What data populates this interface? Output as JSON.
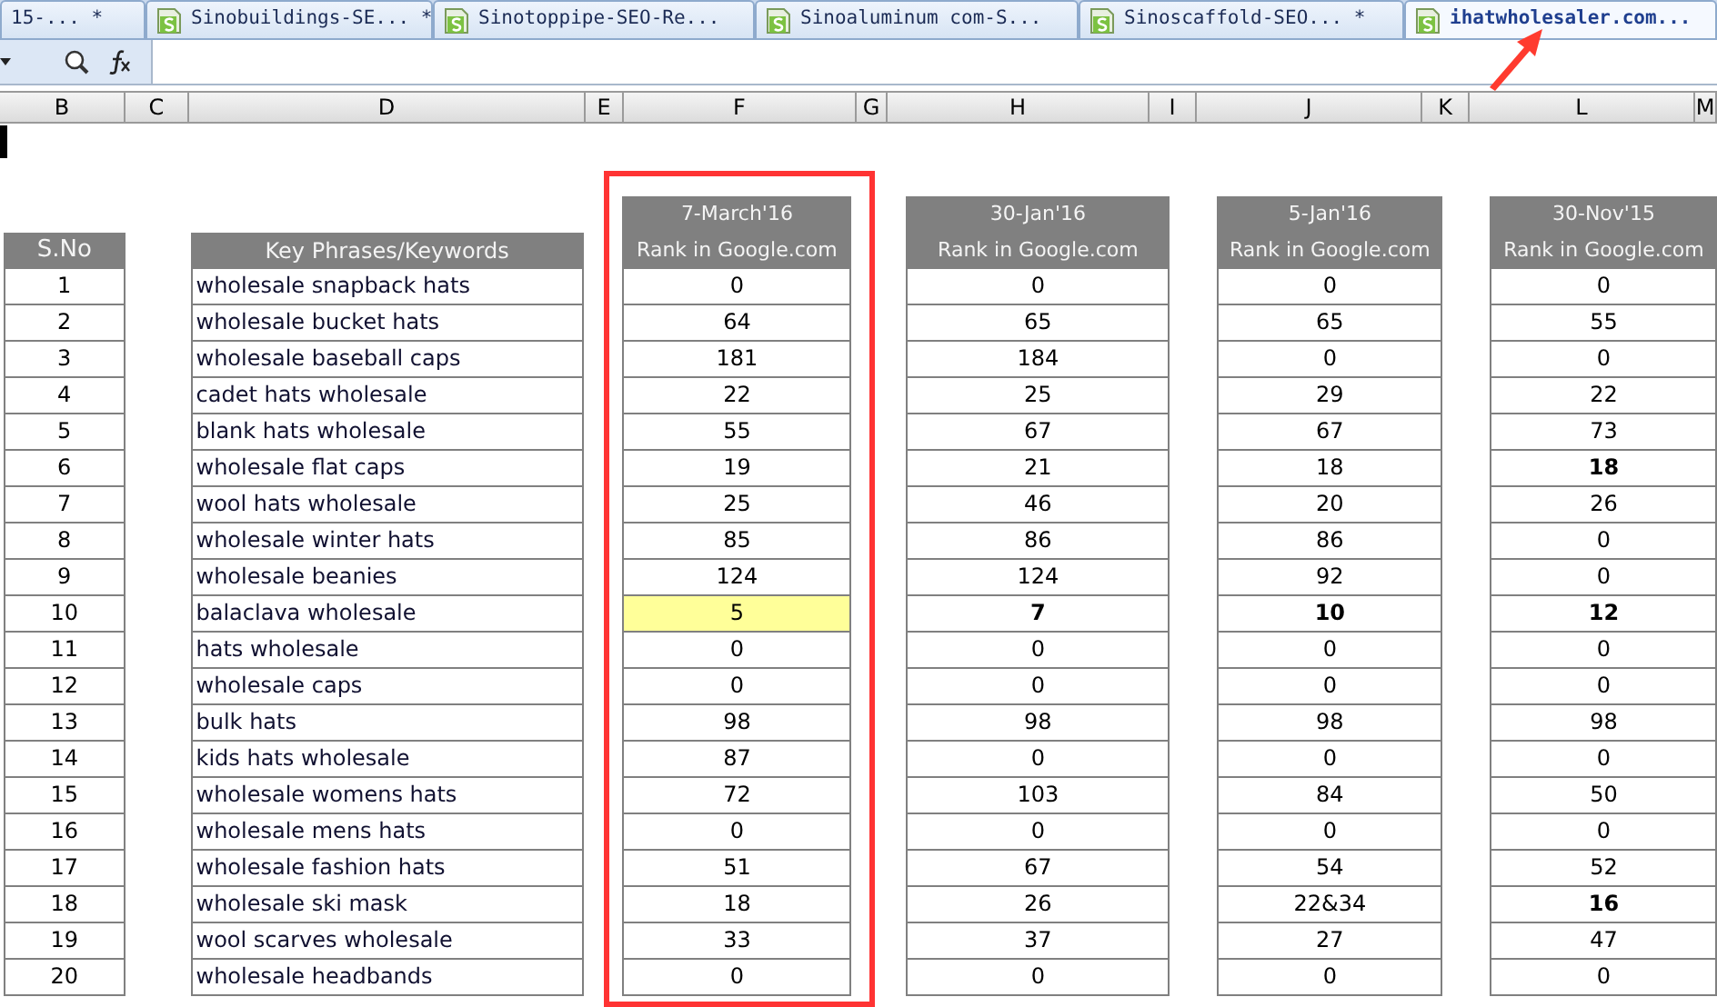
{
  "tabs": [
    {
      "label": "15-... *",
      "selected": false,
      "icon": false,
      "pointed_at": false
    },
    {
      "label": "Sinobuildings-SE... *",
      "selected": false,
      "icon": true,
      "pointed_at": false
    },
    {
      "label": "Sinotoppipe-SEO-Re...",
      "selected": false,
      "icon": true,
      "pointed_at": false
    },
    {
      "label": "Sinoaluminum com-S...",
      "selected": false,
      "icon": true,
      "pointed_at": false
    },
    {
      "label": "Sinoscaffold-SEO... *",
      "selected": false,
      "icon": true,
      "pointed_at": false
    },
    {
      "label": "ihatwholesaler.com...",
      "selected": true,
      "icon": true,
      "pointed_at": true
    }
  ],
  "column_letters": [
    "B",
    "C",
    "D",
    "E",
    "F",
    "G",
    "H",
    "I",
    "J",
    "K",
    "L",
    "M"
  ],
  "table": {
    "sno_header": "S.No",
    "keyword_header": "Key Phrases/Keywords",
    "rows": [
      {
        "sno": "1",
        "keyword": "wholesale snapback hats"
      },
      {
        "sno": "2",
        "keyword": "wholesale bucket hats"
      },
      {
        "sno": "3",
        "keyword": "wholesale baseball caps"
      },
      {
        "sno": "4",
        "keyword": "cadet hats wholesale"
      },
      {
        "sno": "5",
        "keyword": "blank hats wholesale"
      },
      {
        "sno": "6",
        "keyword": "wholesale flat caps"
      },
      {
        "sno": "7",
        "keyword": "wool hats wholesale"
      },
      {
        "sno": "8",
        "keyword": "wholesale winter hats"
      },
      {
        "sno": "9",
        "keyword": "wholesale beanies"
      },
      {
        "sno": "10",
        "keyword": "balaclava wholesale"
      },
      {
        "sno": "11",
        "keyword": "hats wholesale"
      },
      {
        "sno": "12",
        "keyword": "wholesale caps"
      },
      {
        "sno": "13",
        "keyword": "bulk hats"
      },
      {
        "sno": "14",
        "keyword": "kids hats wholesale"
      },
      {
        "sno": "15",
        "keyword": "wholesale womens hats"
      },
      {
        "sno": "16",
        "keyword": "wholesale mens hats"
      },
      {
        "sno": "17",
        "keyword": "wholesale fashion hats"
      },
      {
        "sno": "18",
        "keyword": "wholesale ski mask"
      },
      {
        "sno": "19",
        "keyword": "wool scarves wholesale"
      },
      {
        "sno": "20",
        "keyword": "wholesale headbands"
      }
    ],
    "rank_columns": [
      {
        "date": "7-March'16",
        "subtitle": "Rank in Google.com",
        "outlined": true,
        "values": [
          {
            "text": "0",
            "bold": false,
            "highlighted": false
          },
          {
            "text": "64",
            "bold": false,
            "highlighted": false
          },
          {
            "text": "181",
            "bold": false,
            "highlighted": false
          },
          {
            "text": "22",
            "bold": false,
            "highlighted": false
          },
          {
            "text": "55",
            "bold": false,
            "highlighted": false
          },
          {
            "text": "19",
            "bold": false,
            "highlighted": false
          },
          {
            "text": "25",
            "bold": false,
            "highlighted": false
          },
          {
            "text": "85",
            "bold": false,
            "highlighted": false
          },
          {
            "text": "124",
            "bold": false,
            "highlighted": false
          },
          {
            "text": "5",
            "bold": false,
            "highlighted": true
          },
          {
            "text": "0",
            "bold": false,
            "highlighted": false
          },
          {
            "text": "0",
            "bold": false,
            "highlighted": false
          },
          {
            "text": "98",
            "bold": false,
            "highlighted": false
          },
          {
            "text": "87",
            "bold": false,
            "highlighted": false
          },
          {
            "text": "72",
            "bold": false,
            "highlighted": false
          },
          {
            "text": "0",
            "bold": false,
            "highlighted": false
          },
          {
            "text": "51",
            "bold": false,
            "highlighted": false
          },
          {
            "text": "18",
            "bold": false,
            "highlighted": false
          },
          {
            "text": "33",
            "bold": false,
            "highlighted": false
          },
          {
            "text": "0",
            "bold": false,
            "highlighted": false
          }
        ]
      },
      {
        "date": "30-Jan'16",
        "subtitle": "Rank in Google.com",
        "outlined": false,
        "values": [
          {
            "text": "0",
            "bold": false,
            "highlighted": false
          },
          {
            "text": "65",
            "bold": false,
            "highlighted": false
          },
          {
            "text": "184",
            "bold": false,
            "highlighted": false
          },
          {
            "text": "25",
            "bold": false,
            "highlighted": false
          },
          {
            "text": "67",
            "bold": false,
            "highlighted": false
          },
          {
            "text": "21",
            "bold": false,
            "highlighted": false
          },
          {
            "text": "46",
            "bold": false,
            "highlighted": false
          },
          {
            "text": "86",
            "bold": false,
            "highlighted": false
          },
          {
            "text": "124",
            "bold": false,
            "highlighted": false
          },
          {
            "text": "7",
            "bold": true,
            "highlighted": false
          },
          {
            "text": "0",
            "bold": false,
            "highlighted": false
          },
          {
            "text": "0",
            "bold": false,
            "highlighted": false
          },
          {
            "text": "98",
            "bold": false,
            "highlighted": false
          },
          {
            "text": "0",
            "bold": false,
            "highlighted": false
          },
          {
            "text": "103",
            "bold": false,
            "highlighted": false
          },
          {
            "text": "0",
            "bold": false,
            "highlighted": false
          },
          {
            "text": "67",
            "bold": false,
            "highlighted": false
          },
          {
            "text": "26",
            "bold": false,
            "highlighted": false
          },
          {
            "text": "37",
            "bold": false,
            "highlighted": false
          },
          {
            "text": "0",
            "bold": false,
            "highlighted": false
          }
        ]
      },
      {
        "date": "5-Jan'16",
        "subtitle": "Rank in Google.com",
        "outlined": false,
        "values": [
          {
            "text": "0",
            "bold": false,
            "highlighted": false
          },
          {
            "text": "65",
            "bold": false,
            "highlighted": false
          },
          {
            "text": "0",
            "bold": false,
            "highlighted": false
          },
          {
            "text": "29",
            "bold": false,
            "highlighted": false
          },
          {
            "text": "67",
            "bold": false,
            "highlighted": false
          },
          {
            "text": "18",
            "bold": false,
            "highlighted": false
          },
          {
            "text": "20",
            "bold": false,
            "highlighted": false
          },
          {
            "text": "86",
            "bold": false,
            "highlighted": false
          },
          {
            "text": "92",
            "bold": false,
            "highlighted": false
          },
          {
            "text": "10",
            "bold": true,
            "highlighted": false
          },
          {
            "text": "0",
            "bold": false,
            "highlighted": false
          },
          {
            "text": "0",
            "bold": false,
            "highlighted": false
          },
          {
            "text": "98",
            "bold": false,
            "highlighted": false
          },
          {
            "text": "0",
            "bold": false,
            "highlighted": false
          },
          {
            "text": "84",
            "bold": false,
            "highlighted": false
          },
          {
            "text": "0",
            "bold": false,
            "highlighted": false
          },
          {
            "text": "54",
            "bold": false,
            "highlighted": false
          },
          {
            "text": "22&34",
            "bold": false,
            "highlighted": false
          },
          {
            "text": "27",
            "bold": false,
            "highlighted": false
          },
          {
            "text": "0",
            "bold": false,
            "highlighted": false
          }
        ]
      },
      {
        "date": "30-Nov'15",
        "subtitle": "Rank in Google.com",
        "outlined": false,
        "values": [
          {
            "text": "0",
            "bold": false,
            "highlighted": false
          },
          {
            "text": "55",
            "bold": false,
            "highlighted": false
          },
          {
            "text": "0",
            "bold": false,
            "highlighted": false
          },
          {
            "text": "22",
            "bold": false,
            "highlighted": false
          },
          {
            "text": "73",
            "bold": false,
            "highlighted": false
          },
          {
            "text": "18",
            "bold": true,
            "highlighted": false
          },
          {
            "text": "26",
            "bold": false,
            "highlighted": false
          },
          {
            "text": "0",
            "bold": false,
            "highlighted": false
          },
          {
            "text": "0",
            "bold": false,
            "highlighted": false
          },
          {
            "text": "12",
            "bold": true,
            "highlighted": false
          },
          {
            "text": "0",
            "bold": false,
            "highlighted": false
          },
          {
            "text": "0",
            "bold": false,
            "highlighted": false
          },
          {
            "text": "98",
            "bold": false,
            "highlighted": false
          },
          {
            "text": "0",
            "bold": false,
            "highlighted": false
          },
          {
            "text": "50",
            "bold": false,
            "highlighted": false
          },
          {
            "text": "0",
            "bold": false,
            "highlighted": false
          },
          {
            "text": "52",
            "bold": false,
            "highlighted": false
          },
          {
            "text": "16",
            "bold": true,
            "highlighted": false
          },
          {
            "text": "47",
            "bold": false,
            "highlighted": false
          },
          {
            "text": "0",
            "bold": false,
            "highlighted": false
          }
        ]
      }
    ]
  }
}
